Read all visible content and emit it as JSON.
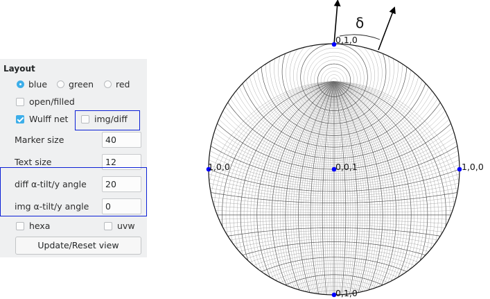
{
  "layout": {
    "title": "Layout",
    "color_options": [
      "blue",
      "green",
      "red"
    ],
    "color_selected": "blue",
    "open_filled_label": "open/filled",
    "wulff_label": "Wulff net",
    "img_diff_label": "img/diff",
    "marker_size_label": "Marker size",
    "marker_size_value": "40",
    "text_size_label": "Text size",
    "text_size_value": "12",
    "diff_tilt_label": "diff α-tilt/y angle",
    "diff_tilt_value": "20",
    "img_tilt_label": "img α-tilt/y angle",
    "img_tilt_value": "0",
    "hexa_label": "hexa",
    "uvw_label": "uvw",
    "update_button": "Update/Reset view"
  },
  "projection": {
    "delta_label": "δ",
    "pole_top": "0,1,0",
    "pole_bottom": "0,1,0",
    "pole_left": "1,0,0",
    "pole_right": "1,0,0",
    "pole_center": "0,0,1",
    "pole_color": "#0000ff",
    "tilt_deg": 20
  },
  "colors": {
    "accent": "#3daee9",
    "highlight": "#0a1fd6"
  }
}
